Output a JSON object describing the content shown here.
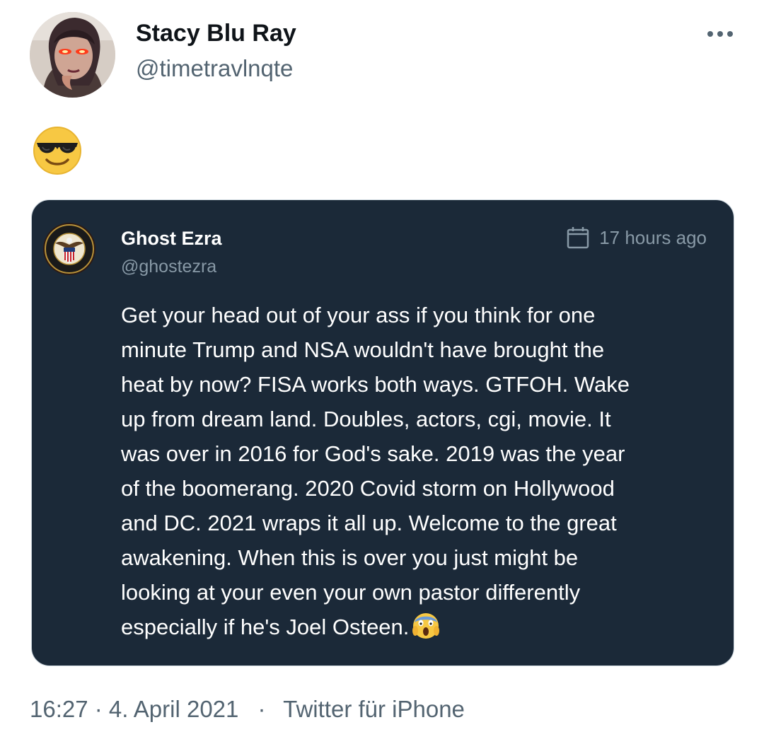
{
  "tweet": {
    "author": {
      "display_name": "Stacy Blu Ray",
      "handle": "@timetravlnqte",
      "avatar": "profile-photo"
    },
    "more_icon": "more-horizontal-icon",
    "text_emoji": "smiling-face-with-sunglasses-emoji",
    "timestamp": "16:27 · 4. April 2021",
    "separator": "·",
    "source": "Twitter für iPhone"
  },
  "quote": {
    "author": {
      "display_name": "Ghost Ezra",
      "handle": "@ghostezra",
      "avatar": "defense-clandestine-service-seal"
    },
    "time_icon": "calendar-icon",
    "time_ago": "17 hours ago",
    "text_lines": [
      "Get your head out of your ass if you think for one",
      "minute Trump and NSA wouldn't have brought the",
      "heat by now? FISA works both ways. GTFOH. Wake",
      "up from dream land. Doubles, actors, cgi, movie. It",
      "was over in 2016 for God's sake. 2019 was the year",
      "of the boomerang. 2020 Covid storm on Hollywood",
      "and DC. 2021 wraps it all up. Welcome to the great",
      "awakening. When this is over you just might be",
      "looking at your even your own pastor differently",
      "especially if he's Joel Osteen."
    ],
    "end_emoji": "face-screaming-in-fear-emoji"
  },
  "colors": {
    "name": "#0f1419",
    "secondary": "#536471",
    "card_background": "#1b2938",
    "card_border": "#c9d3db",
    "card_text": "#ffffff",
    "card_secondary": "#8899a6"
  }
}
